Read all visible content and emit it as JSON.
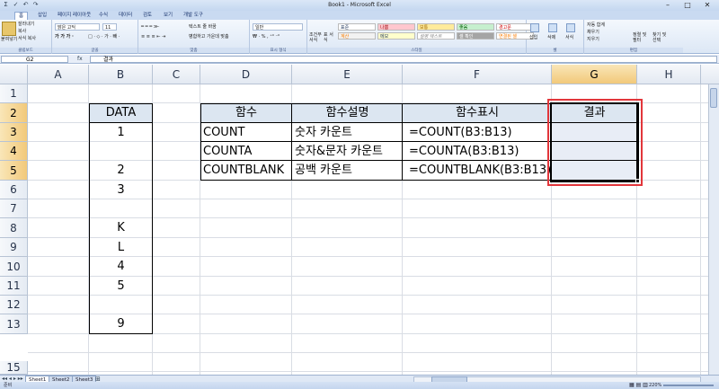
{
  "window": {
    "title": "Book1 - Microsoft Excel",
    "minimize": "–",
    "maximize": "□",
    "close": "✕"
  },
  "quick_access": [
    "Σ",
    "✓",
    "↶",
    "↷"
  ],
  "ribbon_tabs": [
    "홈",
    "삽입",
    "페이지 레이아웃",
    "수식",
    "데이터",
    "검토",
    "보기",
    "개발 도구"
  ],
  "ribbon": {
    "clipboard": {
      "paste": "붙여넣기",
      "cut": "잘라내기",
      "copy": "복사",
      "format_painter": "서식 복사",
      "label": "클립보드"
    },
    "font": {
      "name": "맑은 고딕",
      "size": "11",
      "label": "글꼴"
    },
    "align": {
      "wrap": "텍스트 줄 바꿈",
      "merge": "병합하고 가운데 맞춤",
      "label": "맞춤"
    },
    "number": {
      "format": "일반",
      "label": "표시 형식"
    },
    "styles": {
      "cond": "조건부 서식",
      "table": "표 서식",
      "cells": [
        "표준",
        "나쁨",
        "보통",
        "좋음",
        "경고문",
        "계산",
        "메모",
        "설명 텍스트",
        "셀 확인",
        "연결된 셀"
      ],
      "label": "스타일"
    },
    "cells": {
      "insert": "삽입",
      "delete": "삭제",
      "format": "서식",
      "label": "셀"
    },
    "editing": {
      "autosum": "자동 합계",
      "fill": "채우기",
      "clear": "지우기",
      "sort": "정렬 및 필터",
      "find": "찾기 및 선택",
      "label": "편집"
    }
  },
  "formula_bar": {
    "name_box": "G2",
    "fx": "fx",
    "content": "결과"
  },
  "columns": [
    "A",
    "B",
    "C",
    "D",
    "E",
    "F",
    "G",
    "H"
  ],
  "rows": [
    "1",
    "2",
    "3",
    "4",
    "5",
    "6",
    "7",
    "8",
    "9",
    "10",
    "11",
    "12",
    "13",
    "15"
  ],
  "data_column": {
    "header": "DATA",
    "values": [
      "1",
      "",
      "2",
      "3",
      "",
      "K",
      "L",
      "4",
      "5",
      "",
      "9"
    ]
  },
  "function_table": {
    "headers": [
      "함수",
      "함수설명",
      "함수표시",
      "결과"
    ],
    "rows": [
      [
        "COUNT",
        "숫자 카운트",
        "=COUNT(B3:B13)",
        ""
      ],
      [
        "COUNTA",
        "숫자&문자 카운트",
        "=COUNTA(B3:B13)",
        ""
      ],
      [
        "COUNTBLANK",
        "공백 카운트",
        "=COUNTBLANK(B3:B13)",
        ""
      ]
    ]
  },
  "sheets": [
    "Sheet1",
    "Sheet2",
    "Sheet3"
  ],
  "status": {
    "mode": "준비",
    "zoom": "220%"
  },
  "colors": {
    "selection_border": "#e2363b",
    "result_fill": "#e8edf6",
    "header_fill": "#dce6f1"
  }
}
